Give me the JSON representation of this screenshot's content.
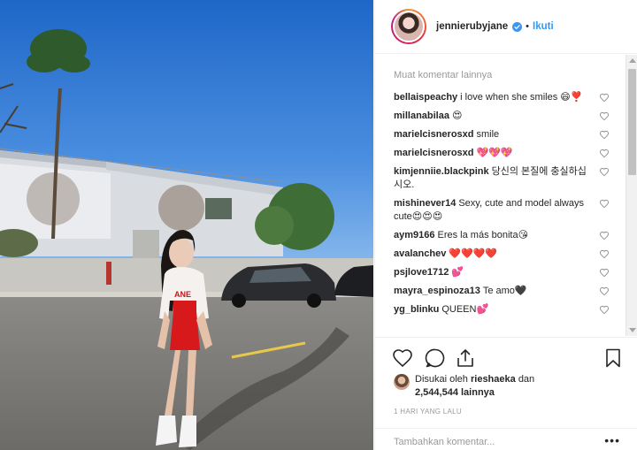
{
  "post": {
    "username": "jennierubyjane",
    "follow_label": "Ikuti",
    "dot": "•",
    "load_more": "Muat komentar lainnya",
    "comments": [
      {
        "user": "bellaispeachy",
        "text": "i love when she smiles 😄❣️"
      },
      {
        "user": "millanabilaa",
        "text": "😍"
      },
      {
        "user": "marielcisnerosxd",
        "text": "smile"
      },
      {
        "user": "marielcisnerosxd",
        "text": "💖💖💖"
      },
      {
        "user": "kimjenniie.blackpink",
        "text": "당신의 본질에 충실하십시오."
      },
      {
        "user": "mishinever14",
        "text": "Sexy, cute and model always cute😍😍😍"
      },
      {
        "user": "aym9166",
        "text": "Eres la más bonita😘"
      },
      {
        "user": "avalanchev",
        "text": "❤️❤️❤️❤️"
      },
      {
        "user": "psjlove1712",
        "text": "💕"
      },
      {
        "user": "mayra_espinoza13",
        "text": "Te amo🖤"
      },
      {
        "user": "yg_blinku",
        "text": "QUEEN💕"
      }
    ],
    "likes": {
      "prefix": "Disukai oleh",
      "user": "rieshaeka",
      "middle": "dan",
      "count": "2,544,544",
      "suffix": "lainnya"
    },
    "timestamp": "1 HARI YANG LALU",
    "add_comment_placeholder": "Tambahkan komentar...",
    "more_options": "•••"
  },
  "icons": {
    "verified": "verified-badge-icon",
    "heart": "heart-outline-icon",
    "comment": "comment-bubble-icon",
    "share": "share-upload-icon",
    "bookmark": "bookmark-icon"
  },
  "colors": {
    "accent": "#3897f0",
    "muted": "#999999",
    "text": "#262626"
  }
}
